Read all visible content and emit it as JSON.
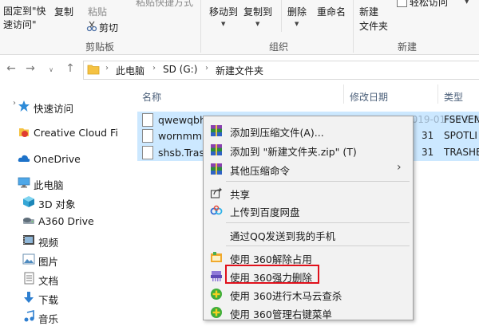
{
  "ribbon": {
    "pin_quick_access": "固定到\"快速访问\"",
    "copy": "复制",
    "paste": "粘贴",
    "paste_shortcut": "粘贴快捷方式",
    "cut": "剪切",
    "clipboard_group": "剪贴板",
    "move_to": "移动到",
    "copy_to": "复制到",
    "delete": "删除",
    "rename": "重命名",
    "organize_group": "组织",
    "new_folder": "新建\n文件夹",
    "new_group": "新建",
    "easy_access": "轻松访问"
  },
  "address": {
    "crumbs": [
      "此电脑",
      "SD (G:)",
      "新建文件夹"
    ]
  },
  "nav": {
    "items": [
      {
        "label": "快速访问",
        "icon": "star-icon"
      },
      {
        "label": "Creative Cloud Fi",
        "icon": "creative-cloud-icon"
      },
      {
        "label": "OneDrive",
        "icon": "cloud-icon"
      },
      {
        "label": "此电脑",
        "icon": "computer-icon"
      },
      {
        "label": "3D 对象",
        "icon": "cube-icon"
      },
      {
        "label": "A360 Drive",
        "icon": "drive-icon"
      },
      {
        "label": "视频",
        "icon": "video-icon"
      },
      {
        "label": "图片",
        "icon": "image-icon"
      },
      {
        "label": "文档",
        "icon": "document-icon"
      },
      {
        "label": "下载",
        "icon": "download-icon"
      },
      {
        "label": "音乐",
        "icon": "music-icon"
      }
    ]
  },
  "columns": {
    "name": "名称",
    "modified": "修改日期",
    "type": "类型"
  },
  "files": [
    {
      "name": "qwewqbhk",
      "date": "2019-01-09 9:29",
      "type": "FSEVEN"
    },
    {
      "name": "wornmm.",
      "date": "31",
      "type": "SPOTLI"
    },
    {
      "name": "shsb.Tras",
      "date": "31",
      "type": "TRASHE"
    }
  ],
  "context_menu": {
    "items": [
      {
        "label": "添加到压缩文件(A)...",
        "icon": "archive-icon"
      },
      {
        "label": "添加到 \"新建文件夹.zip\" (T)",
        "icon": "archive-icon"
      },
      {
        "label": "其他压缩命令",
        "icon": "archive-icon",
        "submenu": true
      },
      {
        "label": "共享",
        "icon": "share-icon"
      },
      {
        "label": "上传到百度网盘",
        "icon": "baidu-cloud-icon"
      },
      {
        "label": "通过QQ发送到我的手机",
        "icon": ""
      },
      {
        "label": "使用 360解除占用",
        "icon": "unlock-360-icon"
      },
      {
        "label": "使用 360强力删除",
        "icon": "shred-360-icon"
      },
      {
        "label": "使用 360进行木马云查杀",
        "icon": "scan-360-icon"
      },
      {
        "label": "使用 360管理右键菜单",
        "icon": "menu-360-icon"
      }
    ]
  }
}
